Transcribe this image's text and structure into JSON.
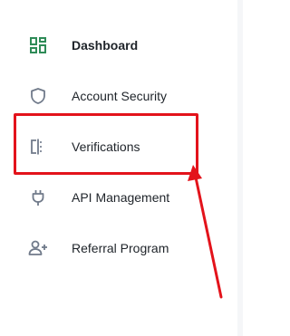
{
  "sidebar": {
    "items": [
      {
        "label": "Dashboard",
        "icon": "dashboard-icon",
        "active": true
      },
      {
        "label": "Account Security",
        "icon": "shield-icon",
        "active": false
      },
      {
        "label": "Verifications",
        "icon": "id-card-icon",
        "active": false
      },
      {
        "label": "API Management",
        "icon": "plug-icon",
        "active": false
      },
      {
        "label": "Referral Program",
        "icon": "add-user-icon",
        "active": false
      }
    ]
  },
  "colors": {
    "active_icon": "#2e8b57",
    "icon": "#707a8a",
    "text": "#1e2329",
    "annotation": "#e3131b"
  }
}
